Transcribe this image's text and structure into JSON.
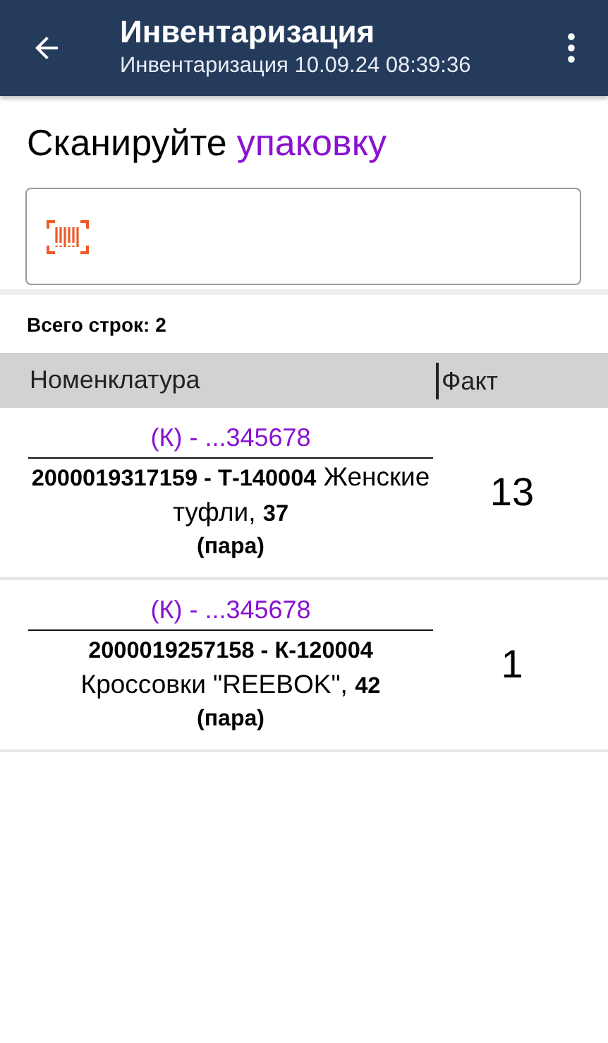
{
  "app_bar": {
    "title": "Инвентаризация",
    "subtitle": "Инвентаризация 10.09.24 08:39:36"
  },
  "prompt": {
    "text": "Сканируйте",
    "target": "упаковку"
  },
  "summary": "Всего строк: 2",
  "table": {
    "columns": [
      "Номенклатура",
      "Факт"
    ],
    "rows": [
      {
        "package": "(К) - ...345678",
        "description": "**2000019317159 - Т-140004** Женские туфли, **37**",
        "unit": "(пара)",
        "fact": "13"
      },
      {
        "package": "(К) - ...345678",
        "description": "**2000019257158 - К-120004** Кроссовки \"REEBOK\", **42**",
        "unit": "(пара)",
        "fact": "1"
      }
    ]
  }
}
